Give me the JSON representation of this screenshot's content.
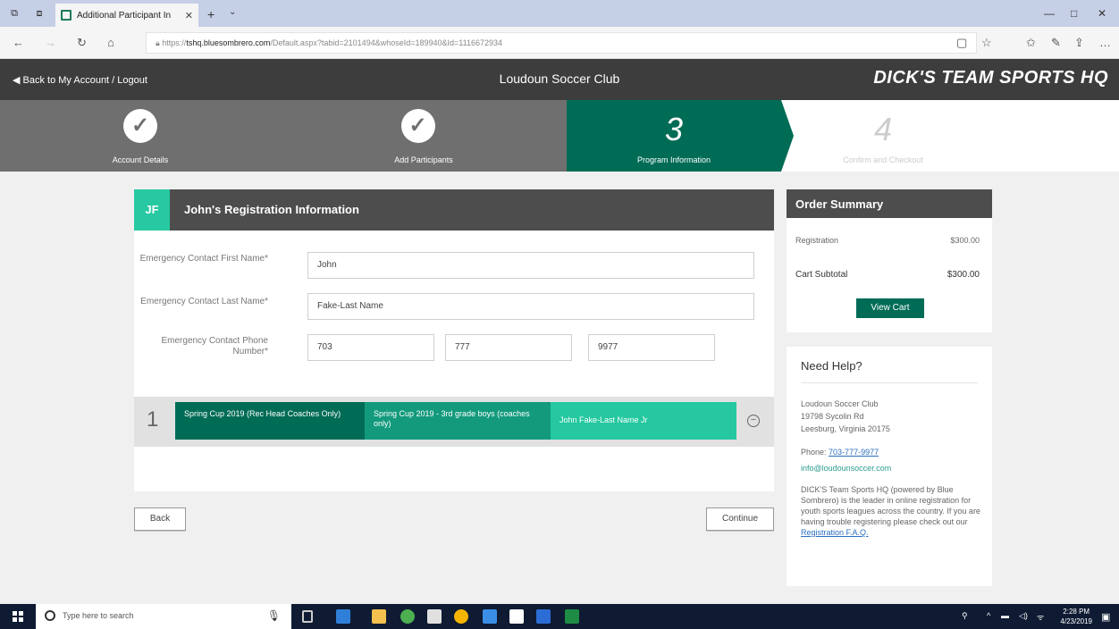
{
  "browser": {
    "tab_title": "Additional Participant In",
    "url_prefix": "https://",
    "url_host": "tshq.bluesombrero.com",
    "url_rest": "/Default.aspx?tabid=2101494&whoseId=189940&Id=1116672934"
  },
  "header": {
    "back_link": "◀  Back to My Account / Logout",
    "club_name": "Loudoun Soccer Club",
    "brand": "DICK'S TEAM SPORTS HQ"
  },
  "steps": [
    {
      "label": "Account Details",
      "state": "done"
    },
    {
      "label": "Add Participants",
      "state": "done"
    },
    {
      "number": "3",
      "label": "Program Information",
      "state": "active"
    },
    {
      "number": "4",
      "label": "Confirm and Checkout",
      "state": "pending"
    }
  ],
  "registration": {
    "badge": "JF",
    "title": "John's Registration Information",
    "fields": {
      "first_name": {
        "label": "Emergency Contact First Name*",
        "value": "John"
      },
      "last_name": {
        "label": "Emergency Contact Last Name*",
        "value": "Fake-Last Name"
      },
      "phone": {
        "label": "Emergency Contact Phone Number*",
        "area": "703",
        "prefix": "777",
        "line": "9977"
      }
    },
    "program": {
      "index": "1",
      "segment1": "Spring Cup 2019 (Rec Head Coaches Only)",
      "segment2": "Spring Cup 2019 - 3rd grade boys (coaches only)",
      "segment3": "John Fake-Last Name Jr"
    }
  },
  "buttons": {
    "back": "Back",
    "continue": "Continue"
  },
  "order_summary": {
    "title": "Order Summary",
    "registration_label": "Registration",
    "registration_value": "$300.00",
    "subtotal_label": "Cart Subtotal",
    "subtotal_value": "$300.00",
    "view_cart": "View Cart"
  },
  "help": {
    "title": "Need Help?",
    "org": "Loudoun Soccer Club",
    "street": "19798 Sycolin Rd",
    "city": "Leesburg, Virginia 20175",
    "phone_label": "Phone:",
    "phone": "703-777-9977",
    "email": "info@loudounsoccer.com",
    "blurb": "DICK'S Team Sports HQ (powered by Blue Sombrero) is the leader in online registration for youth sports leagues across the country. If you are having trouble registering please check out our",
    "faq_link": "Registration F.A.Q."
  },
  "taskbar": {
    "search_placeholder": "Type here to search",
    "time": "2:28 PM",
    "date": "4/23/2019"
  }
}
